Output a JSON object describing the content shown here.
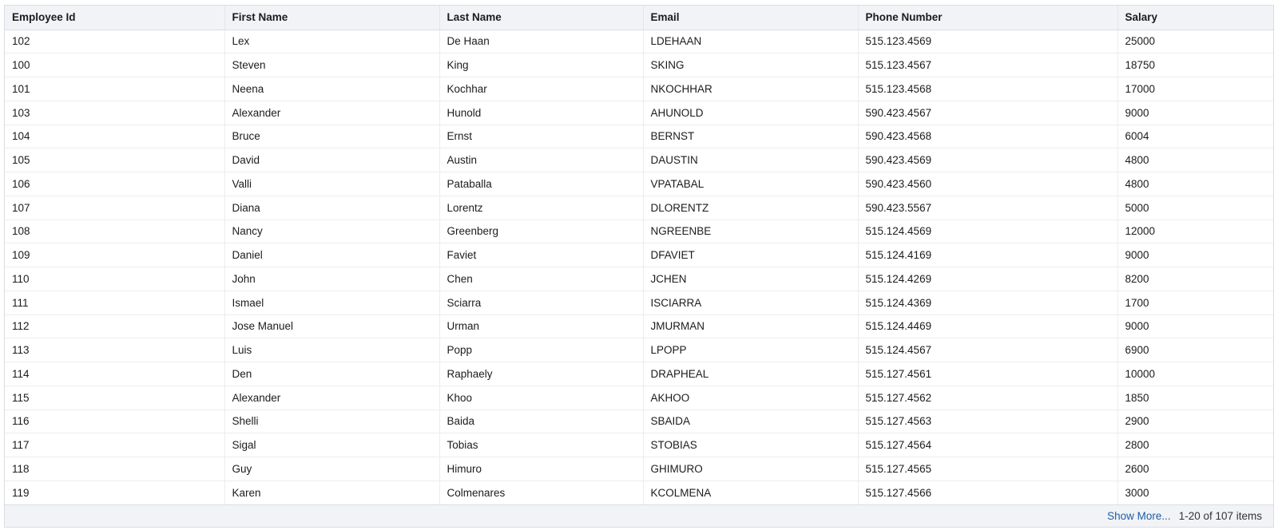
{
  "columns": [
    "Employee Id",
    "First Name",
    "Last Name",
    "Email",
    "Phone Number",
    "Salary"
  ],
  "rows": [
    [
      "102",
      "Lex",
      "De Haan",
      "LDEHAAN",
      "515.123.4569",
      "25000"
    ],
    [
      "100",
      "Steven",
      "King",
      "SKING",
      "515.123.4567",
      "18750"
    ],
    [
      "101",
      "Neena",
      "Kochhar",
      "NKOCHHAR",
      "515.123.4568",
      "17000"
    ],
    [
      "103",
      "Alexander",
      "Hunold",
      "AHUNOLD",
      "590.423.4567",
      "9000"
    ],
    [
      "104",
      "Bruce",
      "Ernst",
      "BERNST",
      "590.423.4568",
      "6004"
    ],
    [
      "105",
      "David",
      "Austin",
      "DAUSTIN",
      "590.423.4569",
      "4800"
    ],
    [
      "106",
      "Valli",
      "Pataballa",
      "VPATABAL",
      "590.423.4560",
      "4800"
    ],
    [
      "107",
      "Diana",
      "Lorentz",
      "DLORENTZ",
      "590.423.5567",
      "5000"
    ],
    [
      "108",
      "Nancy",
      "Greenberg",
      "NGREENBE",
      "515.124.4569",
      "12000"
    ],
    [
      "109",
      "Daniel",
      "Faviet",
      "DFAVIET",
      "515.124.4169",
      "9000"
    ],
    [
      "110",
      "John",
      "Chen",
      "JCHEN",
      "515.124.4269",
      "8200"
    ],
    [
      "111",
      "Ismael",
      "Sciarra",
      "ISCIARRA",
      "515.124.4369",
      "1700"
    ],
    [
      "112",
      "Jose Manuel",
      "Urman",
      "JMURMAN",
      "515.124.4469",
      "9000"
    ],
    [
      "113",
      "Luis",
      "Popp",
      "LPOPP",
      "515.124.4567",
      "6900"
    ],
    [
      "114",
      "Den",
      "Raphaely",
      "DRAPHEAL",
      "515.127.4561",
      "10000"
    ],
    [
      "115",
      "Alexander",
      "Khoo",
      "AKHOO",
      "515.127.4562",
      "1850"
    ],
    [
      "116",
      "Shelli",
      "Baida",
      "SBAIDA",
      "515.127.4563",
      "2900"
    ],
    [
      "117",
      "Sigal",
      "Tobias",
      "STOBIAS",
      "515.127.4564",
      "2800"
    ],
    [
      "118",
      "Guy",
      "Himuro",
      "GHIMURO",
      "515.127.4565",
      "2600"
    ],
    [
      "119",
      "Karen",
      "Colmenares",
      "KCOLMENA",
      "515.127.4566",
      "3000"
    ]
  ],
  "footer": {
    "show_more": "Show More...",
    "range": "1-20 of 107 items"
  },
  "colors": {
    "header_bg": "#f1f3f6",
    "link": "#1f5fa8",
    "border": "#d9dde3"
  }
}
